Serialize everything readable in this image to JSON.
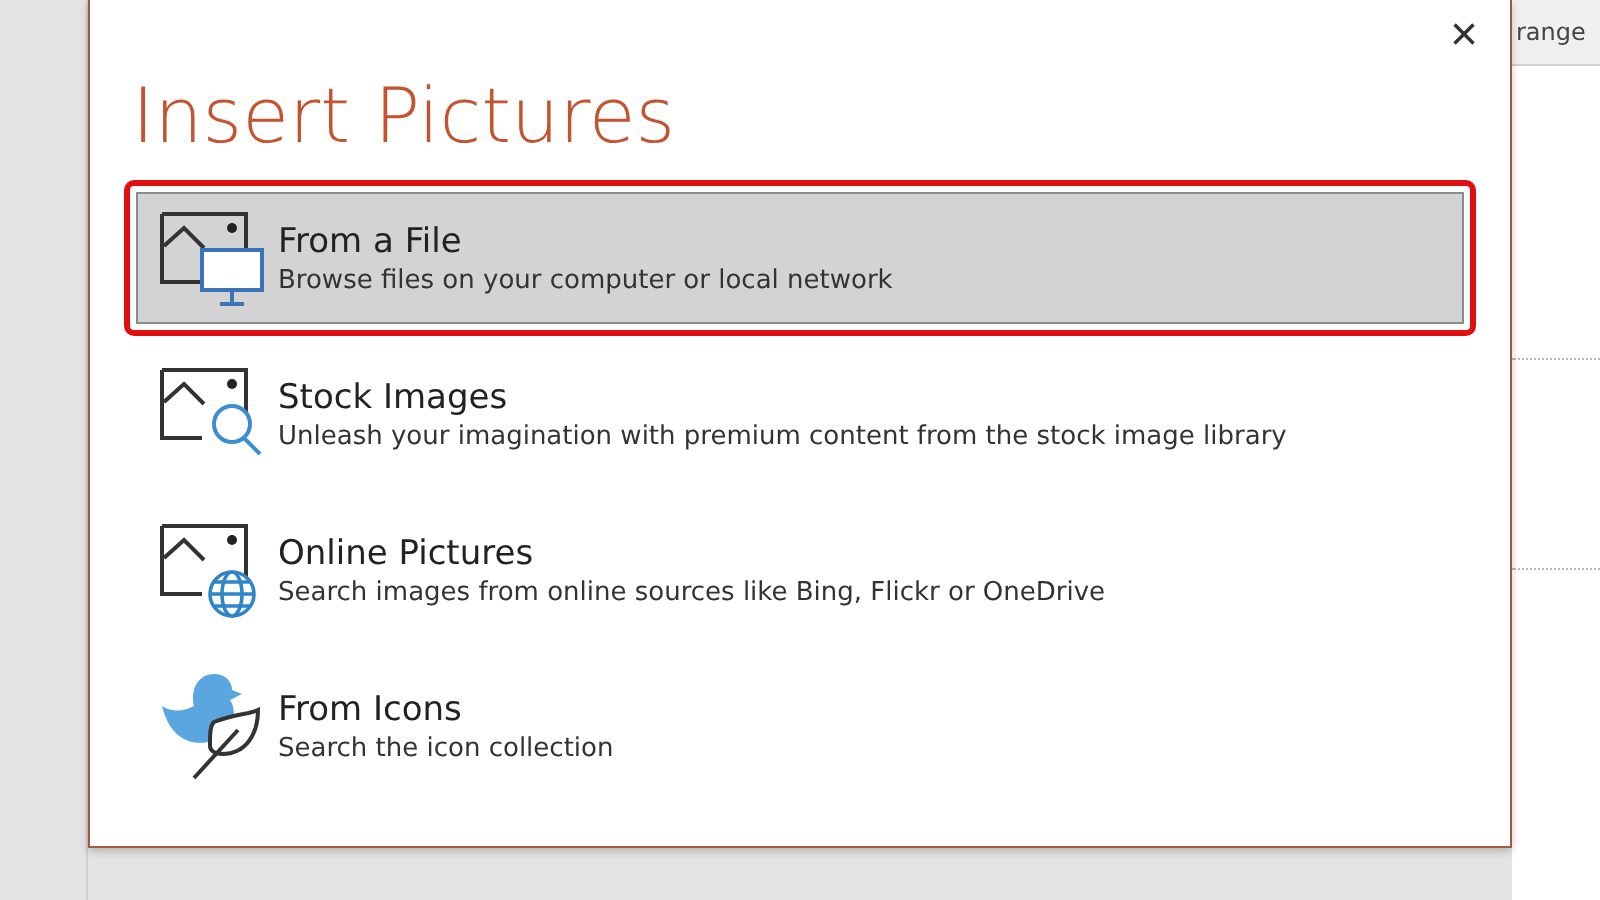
{
  "background": {
    "ribbon_text": "range"
  },
  "dialog": {
    "title": "Insert Pictures",
    "close": "×",
    "options": [
      {
        "kind": "file",
        "title": "From a File",
        "description": "Browse files on your computer or local network",
        "selected": true
      },
      {
        "kind": "stock",
        "title": "Stock Images",
        "description": "Unleash your imagination with premium content from the stock image library",
        "selected": false
      },
      {
        "kind": "online",
        "title": "Online Pictures",
        "description": "Search images from online sources like Bing, Flickr or OneDrive",
        "selected": false
      },
      {
        "kind": "icons",
        "title": "From Icons",
        "description": "Search the icon collection",
        "selected": false
      }
    ]
  }
}
